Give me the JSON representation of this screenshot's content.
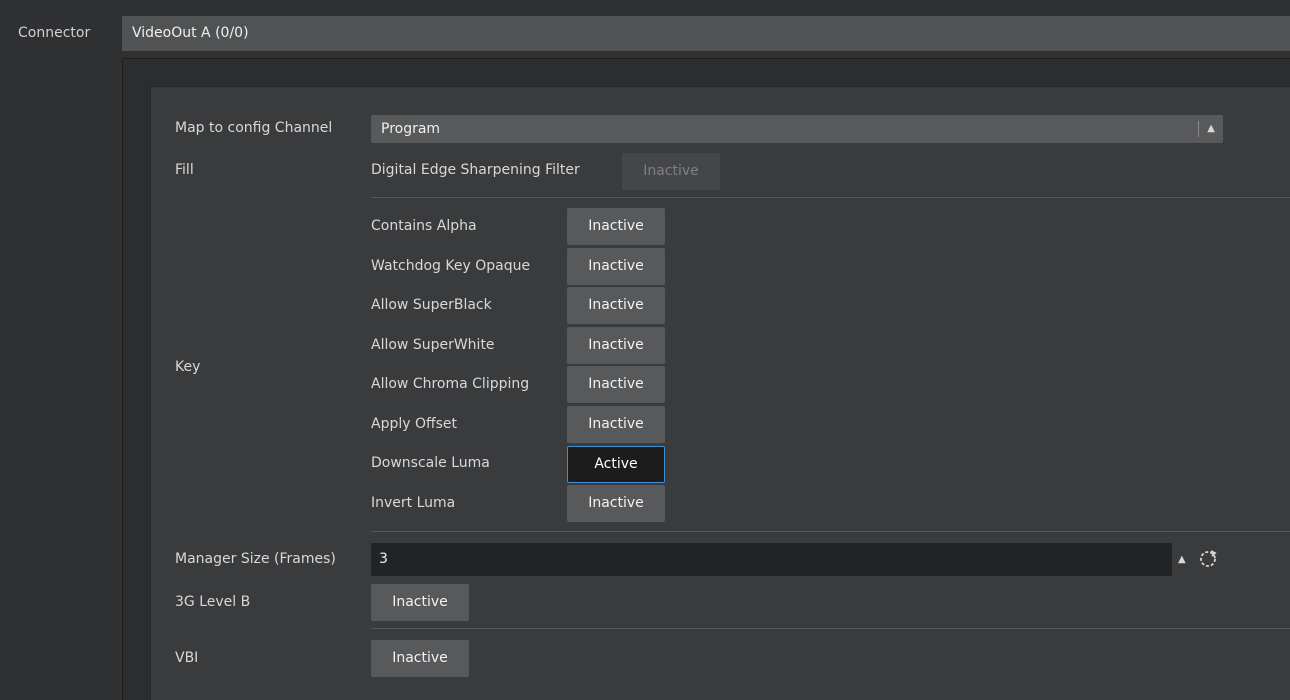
{
  "connector": {
    "label": "Connector",
    "value": "VideoOut A (0/0)"
  },
  "map_channel": {
    "label": "Map to config Channel",
    "value": "Program"
  },
  "fill": {
    "label": "Fill",
    "filter_label": "Digital Edge Sharpening Filter",
    "filter_state": "Inactive"
  },
  "key": {
    "label": "Key",
    "options": [
      {
        "label": "Contains Alpha",
        "state": "Inactive"
      },
      {
        "label": "Watchdog Key Opaque",
        "state": "Inactive"
      },
      {
        "label": "Allow SuperBlack",
        "state": "Inactive"
      },
      {
        "label": "Allow SuperWhite",
        "state": "Inactive"
      },
      {
        "label": "Allow Chroma Clipping",
        "state": "Inactive"
      },
      {
        "label": "Apply Offset",
        "state": "Inactive"
      },
      {
        "label": "Downscale Luma",
        "state": "Active"
      },
      {
        "label": "Invert Luma",
        "state": "Inactive"
      }
    ]
  },
  "manager_size": {
    "label": "Manager Size (Frames)",
    "value": "3"
  },
  "level_3g": {
    "label": "3G Level B",
    "state": "Inactive"
  },
  "vbi": {
    "label": "VBI",
    "state": "Inactive"
  },
  "colors": {
    "accent": "#3f8fd6",
    "button": "#58595b",
    "panel": "#3a3b3d"
  }
}
